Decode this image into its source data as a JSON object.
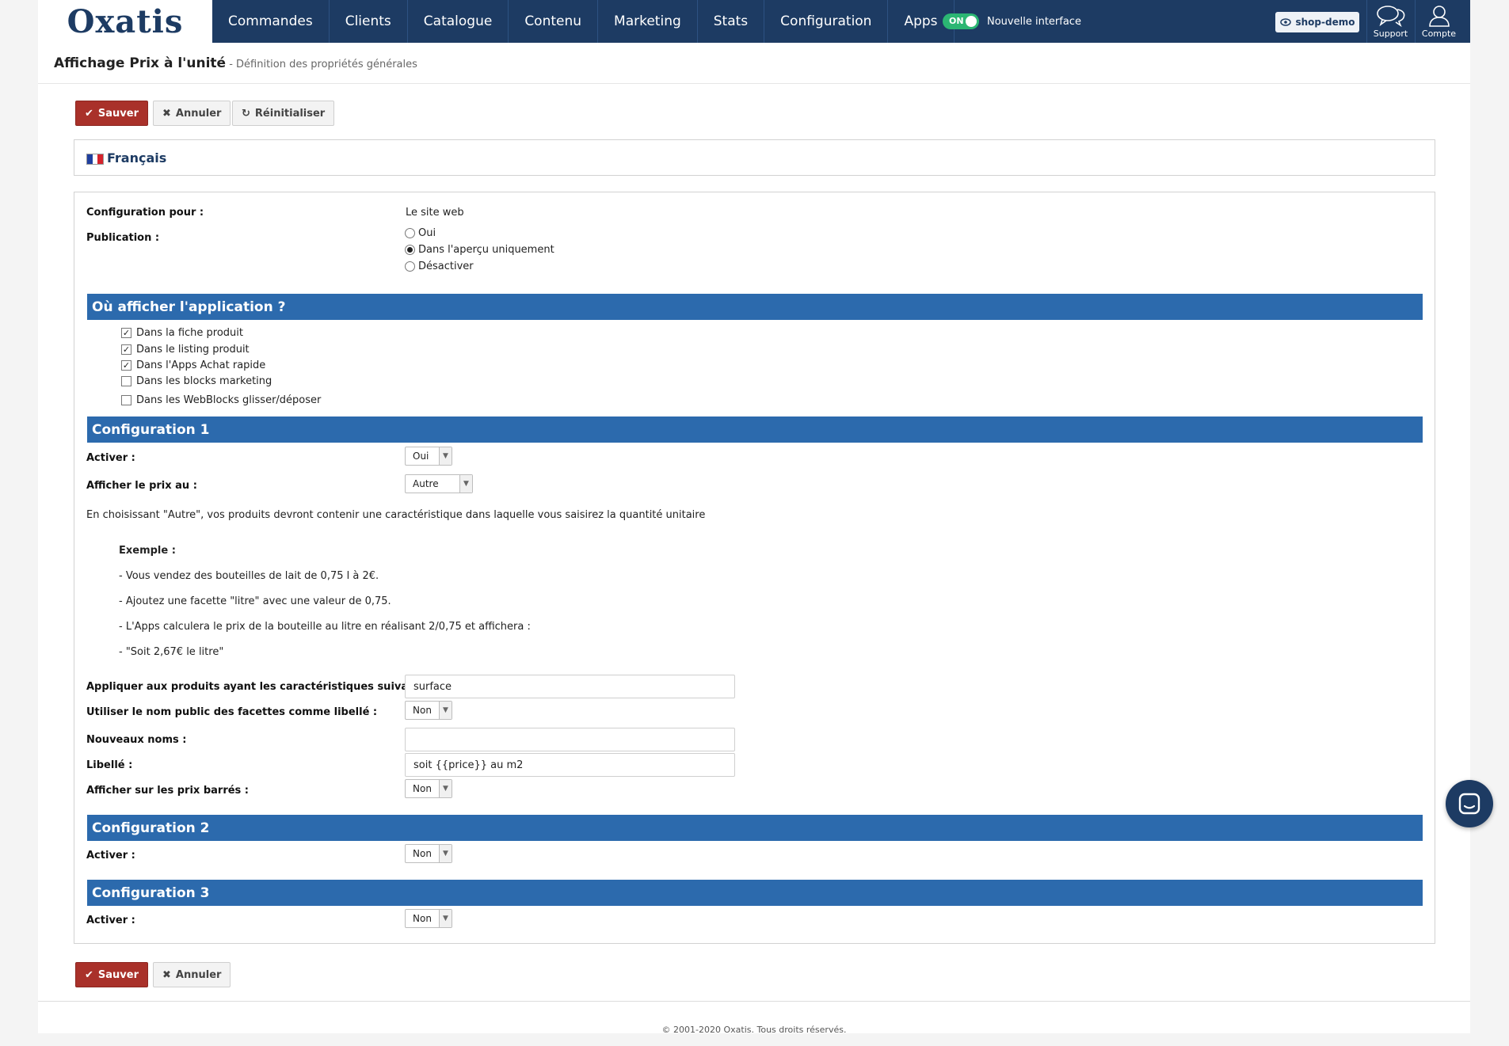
{
  "logo": "Oxatis",
  "nav": {
    "items": [
      "Commandes",
      "Clients",
      "Catalogue",
      "Contenu",
      "Marketing",
      "Stats",
      "Configuration",
      "Apps"
    ]
  },
  "toggle": {
    "state": "ON",
    "label": "Nouvelle interface",
    "color": "#2bb673"
  },
  "shop_button": "shop-demo",
  "support_label": "Support",
  "account_label": "Compte",
  "page": {
    "title": "Affichage Prix à l'unité",
    "subtitle": " - Définition des propriétés générales"
  },
  "buttons": {
    "save": "Sauver",
    "cancel": "Annuler",
    "reset": "Réinitialiser"
  },
  "language": "Français",
  "form": {
    "config_for_label": "Configuration pour :",
    "config_for_value": "Le site web",
    "publication_label": "Publication :",
    "publication_options": [
      "Oui",
      "Dans l'aperçu uniquement",
      "Désactiver"
    ],
    "publication_selected": "Dans l'aperçu uniquement"
  },
  "where_section": {
    "title": "Où afficher l'application ?",
    "options": [
      {
        "label": "Dans la fiche produit",
        "checked": true
      },
      {
        "label": "Dans le listing produit",
        "checked": true
      },
      {
        "label": "Dans l'Apps Achat rapide",
        "checked": true
      },
      {
        "label": "Dans les blocks marketing",
        "checked": false
      },
      {
        "label": "Dans les WebBlocks glisser/déposer",
        "checked": false
      }
    ]
  },
  "config1": {
    "title": "Configuration 1",
    "activer_label": "Activer :",
    "activer_value": "Oui",
    "price_label": "Afficher le prix au :",
    "price_value": "Autre",
    "help": "En choisissant \"Autre\", vos produits devront contenir une caractéristique dans laquelle vous saisirez la quantité unitaire",
    "example_title": "Exemple :",
    "example_lines": [
      "- Vous vendez des bouteilles de lait de 0,75 l à 2€.",
      "- Ajoutez une facette \"litre\" avec une valeur de 0,75.",
      "- L'Apps calculera le prix de la bouteille au litre en réalisant 2/0,75 et affichera :",
      "- \"Soit 2,67€ le litre\""
    ],
    "features_label": "Appliquer aux produits ayant les caractéristiques suivantes :",
    "features_value": "surface",
    "public_name_label": "Utiliser le nom public des facettes comme libellé :",
    "public_name_value": "Non",
    "new_names_label": "Nouveaux noms :",
    "new_names_value": "",
    "libelle_label": "Libellé :",
    "libelle_value": "soit {{price}} au m2",
    "strike_label": "Afficher sur les prix barrés :",
    "strike_value": "Non"
  },
  "config2": {
    "title": "Configuration 2",
    "activer_label": "Activer :",
    "activer_value": "Non"
  },
  "config3": {
    "title": "Configuration 3",
    "activer_label": "Activer :",
    "activer_value": "Non"
  },
  "footer": "© 2001-2020 Oxatis. Tous droits réservés.",
  "colors": {
    "nav_bg": "#1d3b63",
    "section_bg": "#2c6aad",
    "primary_btn": "#a9312a"
  }
}
